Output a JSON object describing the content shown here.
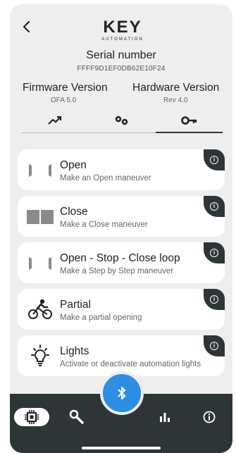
{
  "header": {
    "logo_text": "KEY",
    "logo_subtext": "AUTOMATION",
    "serial_title": "Serial number",
    "serial_value": "FFFF9D1EF0DB62E10F24",
    "firmware_title": "Firmware Version",
    "firmware_value": "OFA 5.0",
    "hardware_title": "Hardware Version",
    "hardware_value": "Rev 4.0"
  },
  "tabs": [
    {
      "icon": "trend-up-icon",
      "active": false
    },
    {
      "icon": "gears-icon",
      "active": false
    },
    {
      "icon": "key-icon",
      "active": true
    }
  ],
  "actions": [
    {
      "title": "Open",
      "subtitle": "Make an Open maneuver",
      "icon": "open-gate-icon"
    },
    {
      "title": "Close",
      "subtitle": "Make a Close maneuver",
      "icon": "close-gate-icon"
    },
    {
      "title": "Open - Stop - Close loop",
      "subtitle": "Make a Step by Step maneuver",
      "icon": "step-gate-icon"
    },
    {
      "title": "Partial",
      "subtitle": "Make a partial opening",
      "icon": "cyclist-icon"
    },
    {
      "title": "Lights",
      "subtitle": "Activate or deactivate automation lights",
      "icon": "lightbulb-icon"
    }
  ],
  "colors": {
    "accent": "#2d8fe3",
    "dark": "#2f3437",
    "background": "#eeeeee"
  },
  "bottom_nav": [
    {
      "icon": "chip-icon",
      "active": true
    },
    {
      "icon": "wrench-icon",
      "active": false
    },
    {
      "icon": "bluetooth-icon",
      "active": false
    },
    {
      "icon": "bar-chart-icon",
      "active": false
    },
    {
      "icon": "info-icon",
      "active": false
    }
  ]
}
